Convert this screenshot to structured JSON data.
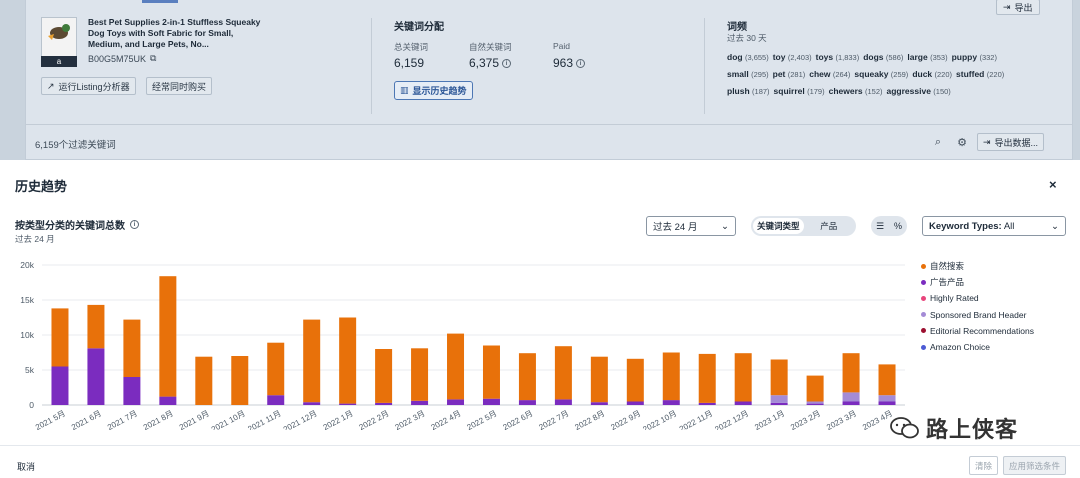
{
  "product": {
    "title": "Best Pet Supplies 2-in-1 Stuffless Squeaky Dog Toys with Soft Fabric for Small, Medium, and Large Pets, No...",
    "asin": "B00G5M75UK",
    "amazon_badge": "a"
  },
  "buttons": {
    "run_listing": "运行Listing分析器",
    "frequently_bought": "经常同时购买",
    "export_top": "导出",
    "show_history": "显示历史趋势",
    "export_data": "导出数据..."
  },
  "keyword_distribution": {
    "title": "关键词分配",
    "total_label": "总关键词",
    "total_value": "6,159",
    "organic_label": "自然关键词",
    "organic_value": "6,375",
    "paid_label": "Paid",
    "paid_value": "963"
  },
  "word_frequency": {
    "title": "词频",
    "period": "过去 30 天",
    "lines": [
      [
        [
          "dog",
          "(3,655)"
        ],
        [
          "toy",
          "(2,403)"
        ],
        [
          "toys",
          "(1,833)"
        ],
        [
          "dogs",
          "(586)"
        ],
        [
          "large",
          "(353)"
        ],
        [
          "puppy",
          "(332)"
        ]
      ],
      [
        [
          "small",
          "(295)"
        ],
        [
          "pet",
          "(281)"
        ],
        [
          "chew",
          "(264)"
        ],
        [
          "squeaky",
          "(259)"
        ],
        [
          "duck",
          "(220)"
        ],
        [
          "stuffed",
          "(220)"
        ]
      ],
      [
        [
          "plush",
          "(187)"
        ],
        [
          "squirrel",
          "(179)"
        ],
        [
          "chewers",
          "(152)"
        ],
        [
          "aggressive",
          "(150)"
        ]
      ]
    ]
  },
  "filter_count": "6,159个过滤关键词",
  "modal": {
    "title": "历史趋势",
    "close": "×",
    "section_title": "按类型分类的关键词总数",
    "section_sub": "过去 24 月",
    "range_select": "过去 24 月",
    "seg_options": [
      "关键词类型",
      "产品"
    ],
    "keyword_types_label": "Keyword Types:",
    "keyword_types_value": "All",
    "cancel": "取消",
    "clear": "清除",
    "apply": "应用筛选条件"
  },
  "watermark": "路上侠客",
  "colors": {
    "organic": "#e8710a",
    "sponsored": "#7b2cbf",
    "highly_rated": "#e8457c",
    "brand_header": "#a48bd6",
    "editorial": "#9c1030",
    "amazon_choice": "#4c5bd4"
  },
  "chart_data": {
    "type": "bar",
    "stacked": true,
    "categories": [
      "2021 5月",
      "2021 6月",
      "2021 7月",
      "2021 8月",
      "2021 9月",
      "2021 10月",
      "2021 11月",
      "2021 12月",
      "2022 1月",
      "2022 2月",
      "2022 3月",
      "2022 4月",
      "2022 5月",
      "2022 6月",
      "2022 7月",
      "2022 8月",
      "2022 9月",
      "2022 10月",
      "2022 11月",
      "2022 12月",
      "2023 1月",
      "2023 2月",
      "2023 3月",
      "2023 4月"
    ],
    "series": [
      {
        "name": "自然搜索",
        "values": [
          8300,
          6200,
          8200,
          17200,
          6900,
          7000,
          7500,
          11800,
          12300,
          7700,
          7500,
          9400,
          7600,
          6700,
          7600,
          6500,
          6100,
          6800,
          7000,
          6900,
          5100,
          3700,
          5600,
          4400
        ]
      },
      {
        "name": "广告产品",
        "values": [
          5500,
          8100,
          4000,
          1200,
          0,
          0,
          1400,
          400,
          200,
          300,
          600,
          800,
          900,
          700,
          800,
          400,
          500,
          700,
          300,
          500,
          300,
          200,
          500,
          500
        ]
      },
      {
        "name": "Highly Rated",
        "values": [
          0,
          0,
          0,
          0,
          0,
          0,
          0,
          0,
          0,
          0,
          0,
          0,
          0,
          0,
          0,
          0,
          0,
          0,
          0,
          0,
          0,
          0,
          0,
          0
        ]
      },
      {
        "name": "Sponsored Brand Header",
        "values": [
          0,
          0,
          0,
          0,
          0,
          0,
          0,
          0,
          0,
          0,
          0,
          0,
          0,
          0,
          0,
          0,
          0,
          0,
          0,
          0,
          1100,
          300,
          1300,
          900
        ]
      },
      {
        "name": "Editorial Recommendations",
        "values": [
          0,
          0,
          0,
          0,
          0,
          0,
          0,
          0,
          0,
          0,
          0,
          0,
          0,
          0,
          0,
          0,
          0,
          0,
          0,
          0,
          0,
          0,
          0,
          0
        ]
      },
      {
        "name": "Amazon Choice",
        "values": [
          0,
          0,
          0,
          0,
          0,
          0,
          0,
          0,
          0,
          0,
          0,
          0,
          0,
          0,
          0,
          0,
          0,
          0,
          0,
          0,
          0,
          0,
          0,
          0
        ]
      }
    ],
    "yticks": [
      "0",
      "5k",
      "10k",
      "15k",
      "20k"
    ],
    "ylim": [
      0,
      20000
    ],
    "grid": true,
    "legend": "right"
  }
}
